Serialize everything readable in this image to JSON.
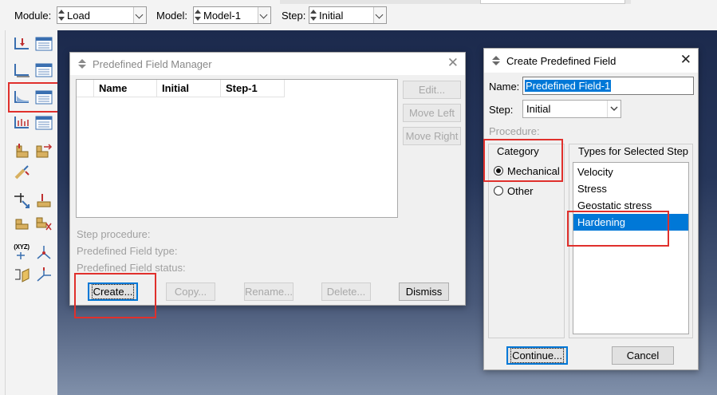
{
  "toolbar": {
    "module_label": "Module:",
    "module_value": "Load",
    "model_label": "Model:",
    "model_value": "Model-1",
    "step_label": "Step:",
    "step_value": "Initial"
  },
  "toolbox": {
    "coordinate_tool_label": "(XYZ)",
    "tools": [
      "create-load-icon",
      "load-manager-icon",
      "create-bc-icon",
      "bc-manager-icon",
      "create-predefined-field-icon",
      "predefined-field-manager-icon",
      "create-load-case-icon",
      "load-case-manager-icon",
      "create-amplitude-icon",
      "amplitude-manager-icon",
      "create-special-icon",
      "create-reference-point-icon",
      "create-datum-icon",
      "create-coupling-icon",
      "create-connector-icon",
      "coordinate-system-icon",
      "datum-axis-icon",
      "datum-plane-icon",
      "datum-csys-icon"
    ]
  },
  "manager": {
    "title": "Predefined Field Manager",
    "columns": [
      "Name",
      "Initial",
      "Step-1"
    ],
    "side_buttons": [
      "Edit...",
      "Move Left",
      "Move Right"
    ],
    "info": [
      "Step procedure:",
      "Predefined Field type:",
      "Predefined Field status:"
    ],
    "buttons": {
      "create": "Create...",
      "copy": "Copy...",
      "rename": "Rename...",
      "delete": "Delete...",
      "dismiss": "Dismiss"
    }
  },
  "create_dialog": {
    "title": "Create Predefined Field",
    "name_label": "Name:",
    "name_value": "Predefined Field-1",
    "step_label": "Step:",
    "step_value": "Initial",
    "procedure_label": "Procedure:",
    "category_title": "Category",
    "categories": [
      {
        "label": "Mechanical",
        "selected": true
      },
      {
        "label": "Other",
        "selected": false
      }
    ],
    "types_title": "Types for Selected Step",
    "types": [
      {
        "label": "Velocity",
        "selected": false
      },
      {
        "label": "Stress",
        "selected": false
      },
      {
        "label": "Geostatic stress",
        "selected": false
      },
      {
        "label": "Hardening",
        "selected": true
      }
    ],
    "continue_label": "Continue...",
    "cancel_label": "Cancel"
  },
  "colors": {
    "highlight_box": "#e0302c",
    "selection": "#0078d7",
    "viewport_top": "#1c2a4d",
    "viewport_bottom": "#8090aa"
  }
}
